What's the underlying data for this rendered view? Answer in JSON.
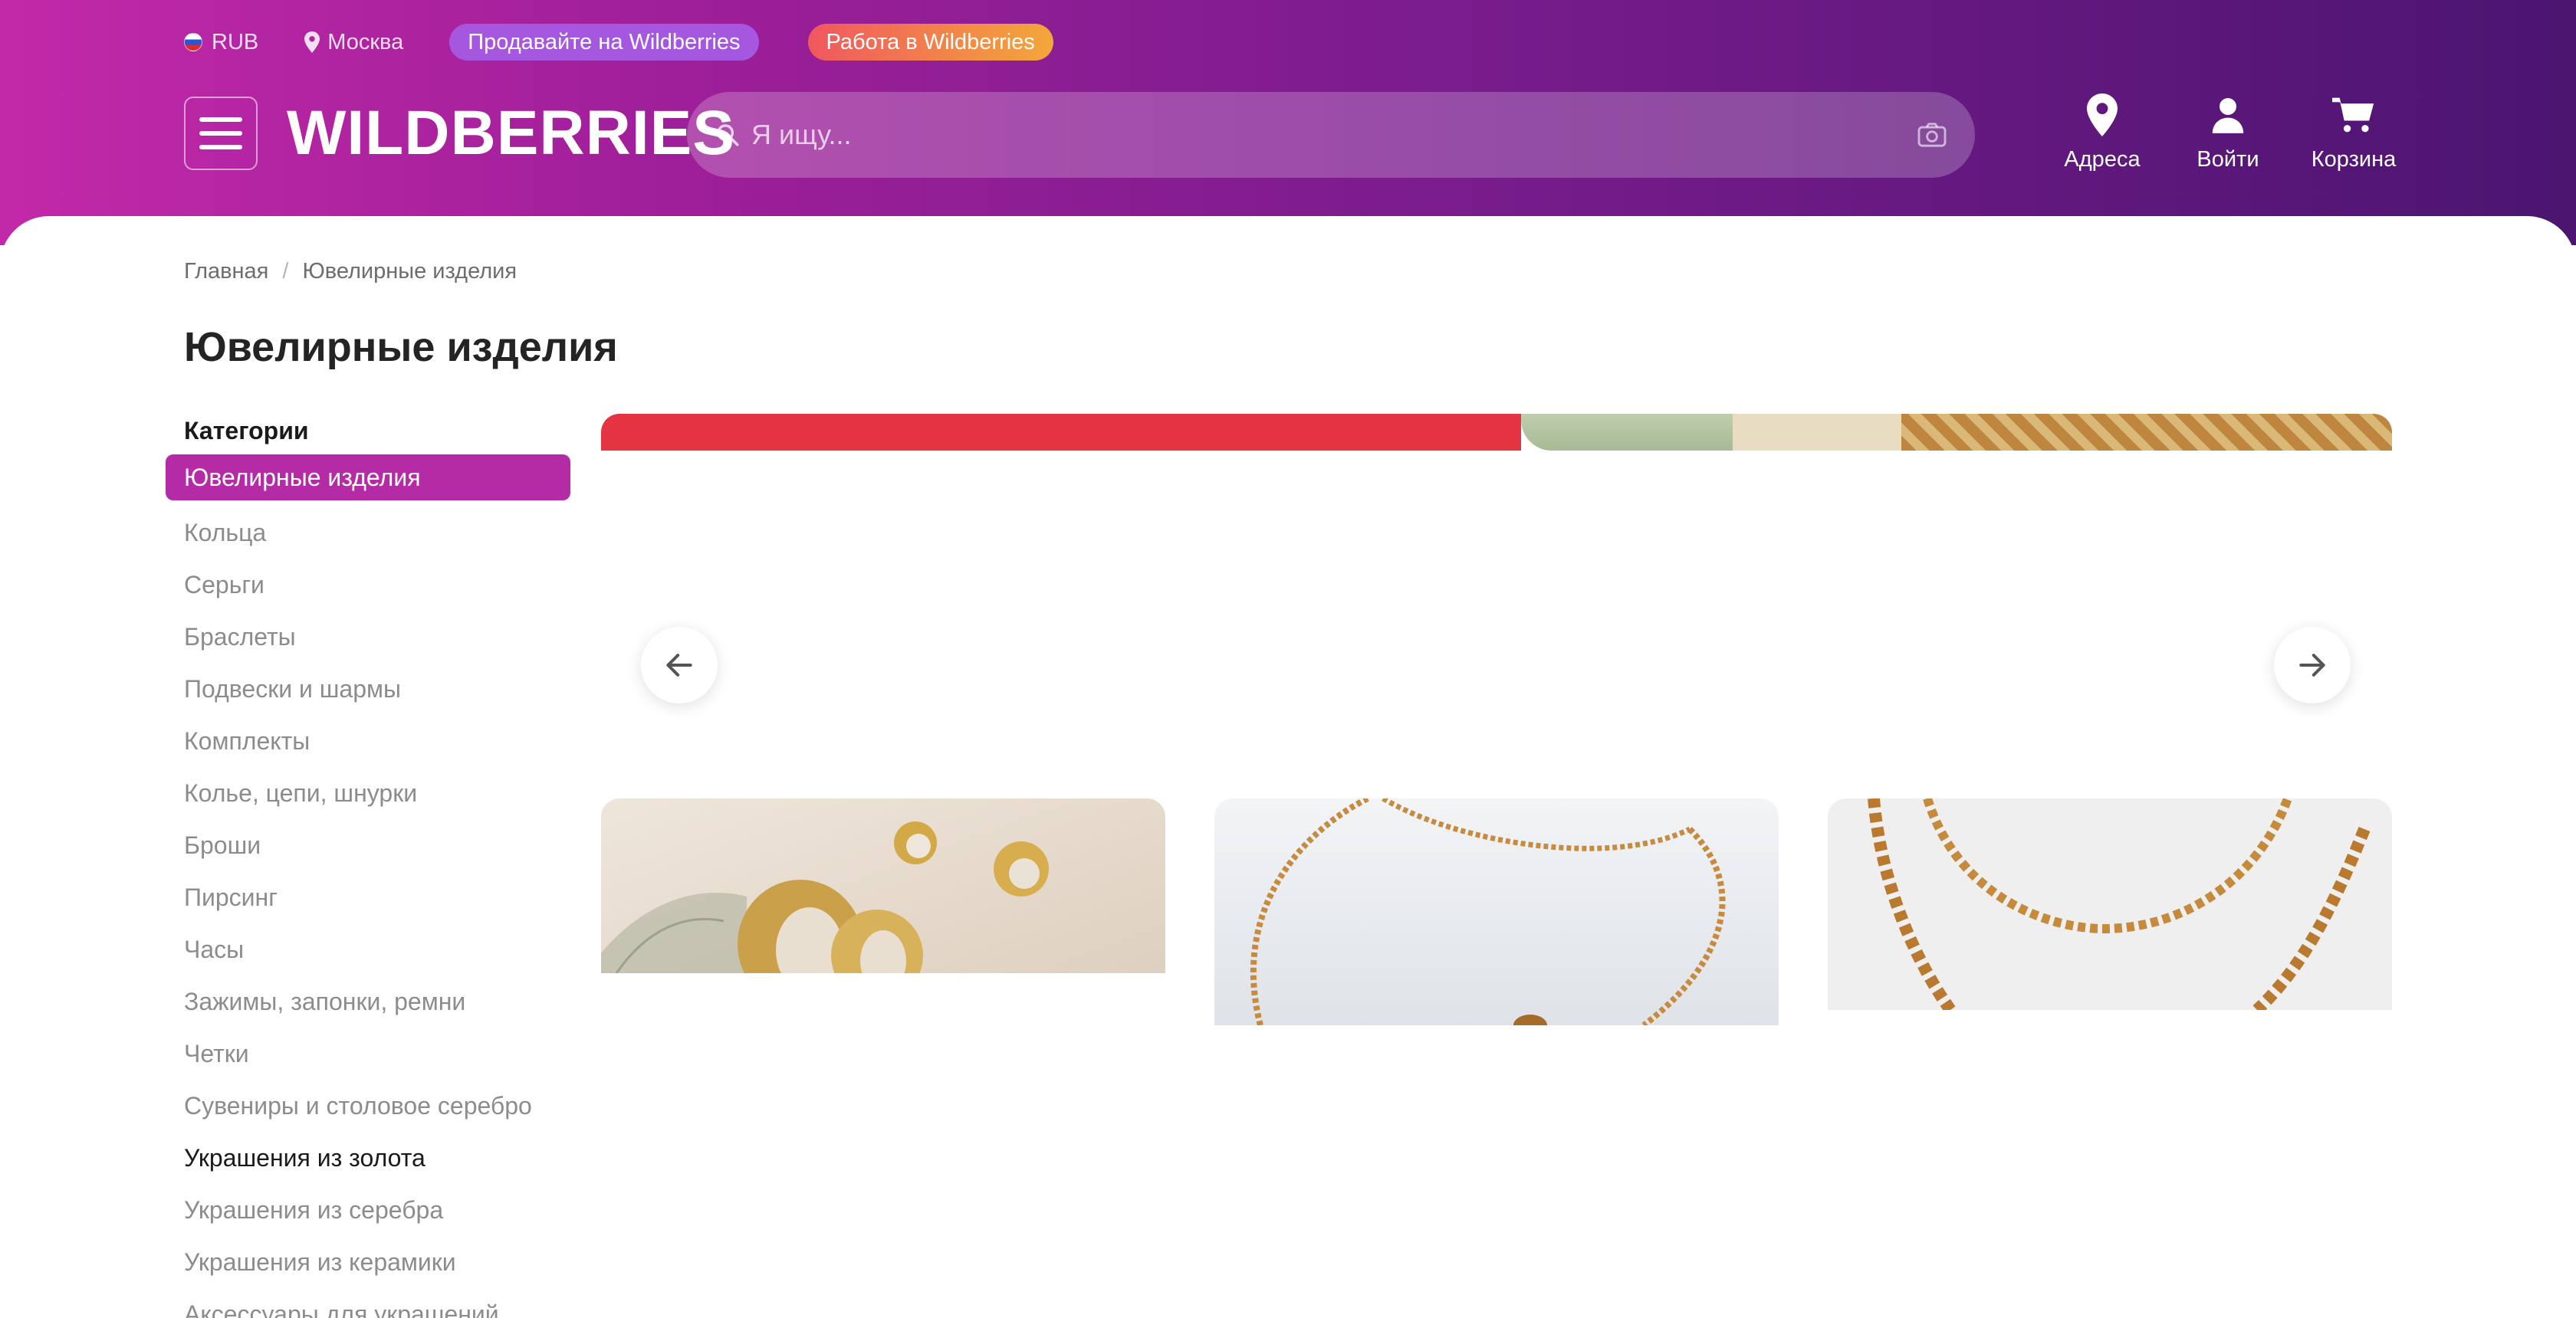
{
  "topbar": {
    "currency": "RUB",
    "city": "Москва",
    "sell_label": "Продавайте на Wildberries",
    "job_label": "Работа в Wildberries"
  },
  "header": {
    "logo": "WILDBERRIES",
    "search_placeholder": "Я ищу...",
    "nav": [
      {
        "label": "Адреса",
        "icon": "location-pin-icon"
      },
      {
        "label": "Войти",
        "icon": "user-icon"
      },
      {
        "label": "Корзина",
        "icon": "cart-icon"
      }
    ]
  },
  "breadcrumb": [
    "Главная",
    "Ювелирные изделия"
  ],
  "page_title": "Ювелирные изделия",
  "sidebar": {
    "heading": "Категории",
    "items": [
      {
        "label": "Ювелирные изделия",
        "state": "active"
      },
      {
        "label": "Кольца"
      },
      {
        "label": "Серьги"
      },
      {
        "label": "Браслеты"
      },
      {
        "label": "Подвески и шармы"
      },
      {
        "label": "Комплекты"
      },
      {
        "label": "Колье, цепи, шнурки"
      },
      {
        "label": "Броши"
      },
      {
        "label": "Пирсинг"
      },
      {
        "label": "Часы"
      },
      {
        "label": "Зажимы, запонки, ремни"
      },
      {
        "label": "Четки"
      },
      {
        "label": "Сувениры и столовое серебро"
      },
      {
        "label": "Украшения из золота",
        "state": "dark"
      },
      {
        "label": "Украшения из серебра"
      },
      {
        "label": "Украшения из керамики"
      },
      {
        "label": "Аксессуары для украшений"
      }
    ]
  },
  "carousel": {
    "slide_count": 3,
    "active_slide": 1
  },
  "colors": {
    "accent": "#b52aa5",
    "header_start": "#c229a9",
    "header_end": "#4b1570",
    "banner_red": "#e53441"
  }
}
